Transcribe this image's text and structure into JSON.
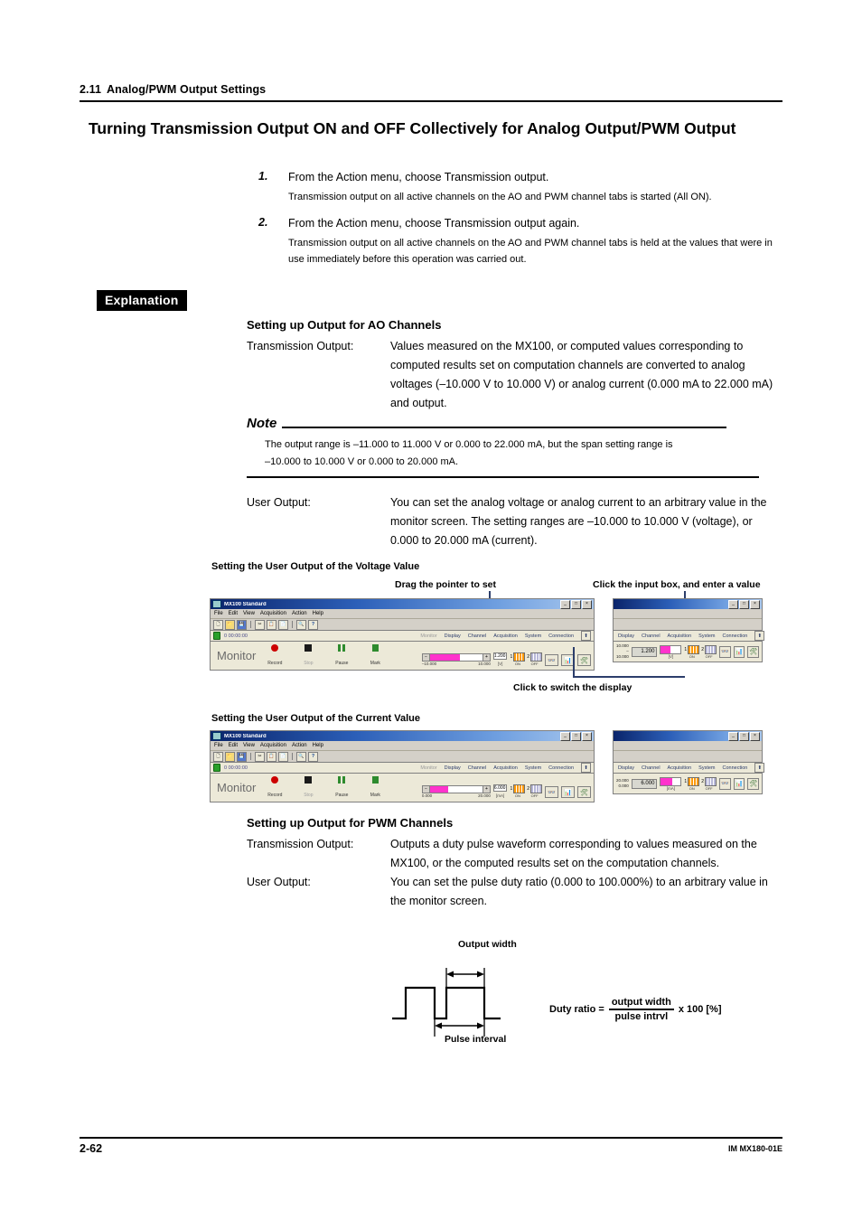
{
  "header": {
    "section_number": "2.11",
    "section_title": "Analog/PWM Output Settings",
    "page_title": "Turning Transmission Output ON and OFF Collectively for Analog Output/PWM Output"
  },
  "steps": [
    {
      "number": "1.",
      "lead": "From the Action menu, choose Transmission output.",
      "detail": "Transmission output on all active channels on the AO and PWM channel tabs is started (All ON)."
    },
    {
      "number": "2.",
      "lead": "From the Action menu, choose Transmission output again.",
      "detail": "Transmission output on all active channels on the AO and PWM channel tabs is held at the values that were in use immediately before this operation was carried out."
    }
  ],
  "explanation_label": "Explanation",
  "ao_section": {
    "heading": "Setting up Output for AO Channels",
    "transmission_term": "Transmission Output:",
    "transmission_desc": "Values measured on the MX100, or computed values corresponding to computed results set on computation channels are converted to analog voltages (–10.000 V to 10.000 V) or analog current (0.000 mA to 22.000 mA) and output.",
    "user_term": "User Output:",
    "user_desc": "You can set the analog voltage or analog current to an arbitrary value in the monitor screen. The setting ranges are –10.000 to 10.000 V (voltage), or 0.000 to 20.000 mA (current)."
  },
  "note": {
    "title": "Note",
    "line1": "The output range is –11.000 to 11.000 V or 0.000 to 22.000 mA, but the span setting range is",
    "line2": "–10.000 to 10.000 V or 0.000 to 20.000 mA."
  },
  "figures": {
    "voltage_caption": "Setting the User Output of the Voltage Value",
    "current_caption": "Setting the User Output of the Current Value",
    "annot_drag": "Drag the pointer to set",
    "annot_click_input": "Click the input box, and enter a value",
    "annot_switch": "Click to switch the display"
  },
  "mx_window": {
    "title": "MX100 Standard",
    "menu": [
      "File",
      "Edit",
      "View",
      "Acquisition",
      "Action",
      "Help"
    ],
    "toolbar_icons": [
      "new-icon",
      "open-icon",
      "save-icon",
      "cut-icon",
      "copy-icon",
      "paste-icon",
      "zoom-icon",
      "help-icon"
    ],
    "status_time": "0 00:00:00",
    "nav_tabs": [
      "Monitor",
      "Display",
      "Channel",
      "Acquisition",
      "System",
      "Connection"
    ],
    "monitor_label": "Monitor",
    "transport": [
      {
        "name": "Record",
        "label": "Record"
      },
      {
        "name": "Stop",
        "label": "Stop"
      },
      {
        "name": "Pause",
        "label": "Pause"
      },
      {
        "name": "Mark",
        "label": "Mark"
      }
    ],
    "minimize": "_",
    "maximize": "□",
    "close": "×"
  },
  "voltage_panel": {
    "scale_min": "–10.000",
    "scale_max": "10.000",
    "value": "1.200",
    "unit": "[V]",
    "channel1_num": "1",
    "channel1_state": "ON",
    "channel2_num": "2",
    "channel2_state": "OFF"
  },
  "current_panel": {
    "scale_min": "0.000",
    "scale_max": "20.000",
    "value": "6.000",
    "unit": "[mA]",
    "channel1_num": "1",
    "channel1_state": "ON",
    "channel2_num": "2",
    "channel2_state": "OFF"
  },
  "pwm_section": {
    "heading": "Setting up Output for PWM Channels",
    "transmission_term": "Transmission Output:",
    "transmission_desc": "Outputs a duty pulse waveform corresponding to values measured on the MX100, or the computed results set on the computation channels.",
    "user_term": "User Output:",
    "user_desc": "You can set the pulse duty ratio (0.000 to 100.000%) to an arbitrary value in the monitor screen."
  },
  "pwm_diagram": {
    "output_width_label": "Output width",
    "pulse_interval_label": "Pulse interval",
    "duty_prefix": "Duty ratio =",
    "numerator": "output width",
    "denominator": "pulse intrvl",
    "multiplier": "x 100 [%]"
  },
  "footer": {
    "page_number": "2-62",
    "doc_code": "IM MX180-01E"
  }
}
